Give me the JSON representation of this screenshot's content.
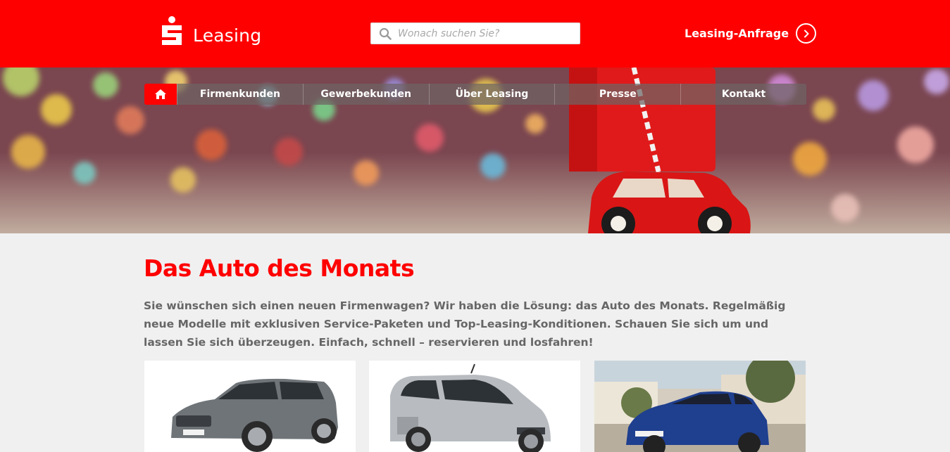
{
  "header": {
    "brand": "Leasing",
    "search_placeholder": "Wonach suchen Sie?",
    "request_label": "Leasing-Anfrage",
    "brand_color": "#ff0000"
  },
  "nav": {
    "home_icon": "home-icon",
    "items": [
      {
        "label": "Firmenkunden"
      },
      {
        "label": "Gewerbekunden"
      },
      {
        "label": "Über Leasing"
      },
      {
        "label": "Presse"
      },
      {
        "label": "Kontakt"
      }
    ]
  },
  "main": {
    "title": "Das Auto des Monats",
    "intro": "Sie wünschen sich einen neuen Firmenwagen? Wir haben die Lösung: das Auto des Monats. Regelmäßig neue Model­le mit exklusiven Service-Paketen und Top-Leasing-Konditionen. Schauen Sie sich um und lassen Sie sich überzeu­gen. Einfach, schnell – reservieren und losfahren!"
  }
}
